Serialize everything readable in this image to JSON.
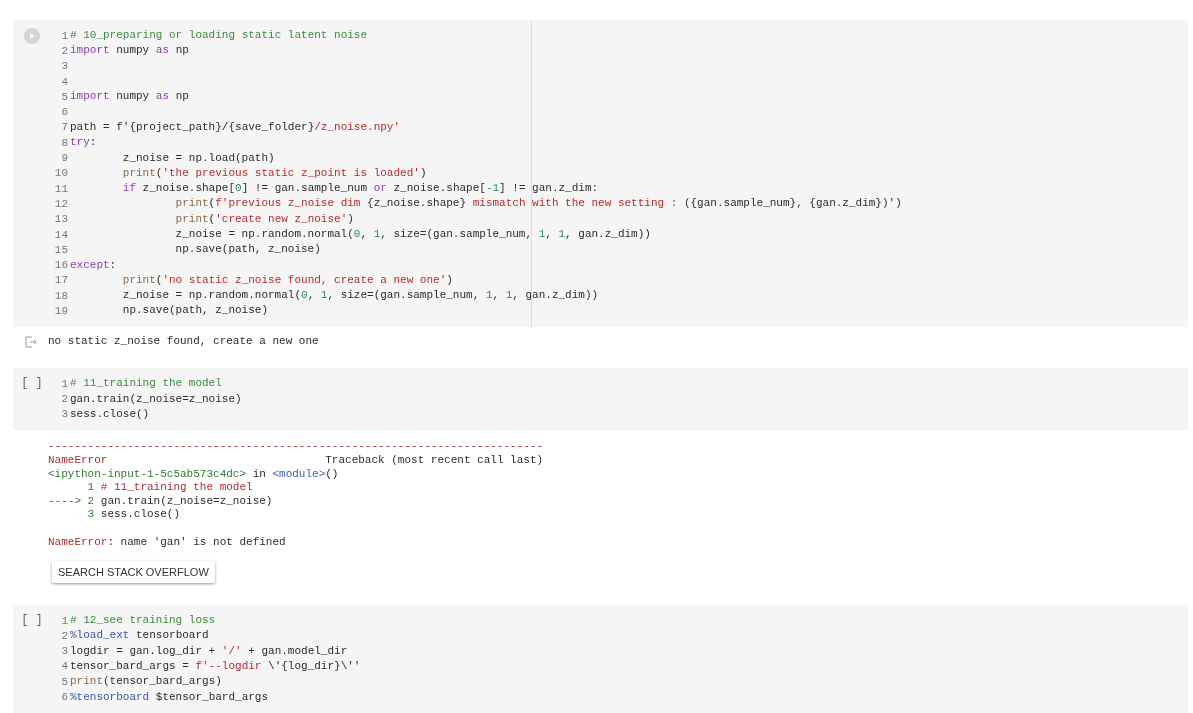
{
  "cells": [
    {
      "gutter": {
        "kind": "run"
      },
      "focused": true,
      "lines": [
        {
          "n": "1",
          "tokens": [
            {
              "kind": "comment",
              "text": "# 10_preparing or loading static latent noise"
            }
          ]
        },
        {
          "n": "2",
          "tokens": [
            {
              "kind": "keyword",
              "text": "import"
            },
            {
              "kind": "plain",
              "text": " numpy "
            },
            {
              "kind": "keyword",
              "text": "as"
            },
            {
              "kind": "plain",
              "text": " np"
            }
          ]
        },
        {
          "n": "3"
        },
        {
          "n": "4"
        },
        {
          "n": "5",
          "tokens": [
            {
              "kind": "keyword",
              "text": "import"
            },
            {
              "kind": "plain",
              "text": " numpy "
            },
            {
              "kind": "keyword",
              "text": "as"
            },
            {
              "kind": "plain",
              "text": " np"
            }
          ]
        },
        {
          "n": "6"
        },
        {
          "n": "7",
          "tokens": [
            {
              "kind": "plain",
              "text": "path = f'{project_path}/{save_folder}"
            },
            {
              "kind": "string",
              "text": "/z_noise.npy'"
            }
          ]
        },
        {
          "n": "8",
          "tokens": [
            {
              "kind": "keyword",
              "text": "try"
            },
            {
              "kind": "plain",
              "text": ":"
            }
          ],
          "children": [
            {
              "n": "9",
              "tokens": [
                {
                  "kind": "plain",
                  "text": "z_noise = np.load(path)"
                }
              ]
            },
            {
              "n": "10",
              "tokens": [
                {
                  "kind": "builtin",
                  "text": "print"
                },
                {
                  "kind": "plain",
                  "text": "("
                },
                {
                  "kind": "string",
                  "text": "'the previous static z_point is loaded'"
                },
                {
                  "kind": "plain",
                  "text": ")"
                }
              ]
            },
            {
              "n": "11",
              "tokens": [
                {
                  "kind": "keyword",
                  "text": "if"
                },
                {
                  "kind": "plain",
                  "text": " z_noise.shape["
                },
                {
                  "kind": "number",
                  "text": "0"
                },
                {
                  "kind": "plain",
                  "text": "] != gan.sample_num "
                },
                {
                  "kind": "keyword",
                  "text": "or"
                },
                {
                  "kind": "plain",
                  "text": " z_noise.shape["
                },
                {
                  "kind": "number",
                  "text": "-1"
                },
                {
                  "kind": "plain",
                  "text": "] != gan.z_dim:"
                }
              ],
              "children": [
                {
                  "n": "12",
                  "tokens": [
                    {
                      "kind": "builtin",
                      "text": "print"
                    },
                    {
                      "kind": "plain",
                      "text": "("
                    },
                    {
                      "kind": "string",
                      "text": "f'previous z_noise dim "
                    },
                    {
                      "kind": "plain",
                      "text": "{z_noise.shape}"
                    },
                    {
                      "kind": "string",
                      "text": " mismatch with the new setting : "
                    },
                    {
                      "kind": "plain",
                      "text": "({gan.sample_num}, {gan.z_dim})')"
                    }
                  ]
                },
                {
                  "n": "13",
                  "tokens": [
                    {
                      "kind": "builtin",
                      "text": "print"
                    },
                    {
                      "kind": "plain",
                      "text": "("
                    },
                    {
                      "kind": "string",
                      "text": "'create new z_noise'"
                    },
                    {
                      "kind": "plain",
                      "text": ")"
                    }
                  ]
                },
                {
                  "n": "14",
                  "tokens": [
                    {
                      "kind": "plain",
                      "text": "z_noise = np.random.normal("
                    },
                    {
                      "kind": "number",
                      "text": "0"
                    },
                    {
                      "kind": "plain",
                      "text": ", "
                    },
                    {
                      "kind": "number",
                      "text": "1"
                    },
                    {
                      "kind": "plain",
                      "text": ", size=(gan.sample_num, "
                    },
                    {
                      "kind": "number",
                      "text": "1"
                    },
                    {
                      "kind": "plain",
                      "text": ", "
                    },
                    {
                      "kind": "number",
                      "text": "1"
                    },
                    {
                      "kind": "plain",
                      "text": ", gan.z_dim))"
                    }
                  ]
                },
                {
                  "n": "15",
                  "tokens": [
                    {
                      "kind": "plain",
                      "text": "np.save(path, z_noise)"
                    }
                  ]
                }
              ]
            }
          ]
        },
        {
          "n": "16",
          "tokens": [
            {
              "kind": "keyword",
              "text": "except"
            },
            {
              "kind": "plain",
              "text": ":"
            }
          ],
          "children": [
            {
              "n": "17",
              "tokens": [
                {
                  "kind": "builtin",
                  "text": "print"
                },
                {
                  "kind": "plain",
                  "text": "("
                },
                {
                  "kind": "string",
                  "text": "'no static z_noise found, create a new one'"
                },
                {
                  "kind": "plain",
                  "text": ")"
                }
              ]
            },
            {
              "n": "18",
              "tokens": [
                {
                  "kind": "plain",
                  "text": "z_noise = np.random.normal("
                },
                {
                  "kind": "number",
                  "text": "0"
                },
                {
                  "kind": "plain",
                  "text": ", "
                },
                {
                  "kind": "number",
                  "text": "1"
                },
                {
                  "kind": "plain",
                  "text": ", size=(gan.sample_num, "
                },
                {
                  "kind": "number",
                  "text": "1"
                },
                {
                  "kind": "plain",
                  "text": ", "
                },
                {
                  "kind": "number",
                  "text": "1"
                },
                {
                  "kind": "plain",
                  "text": ", gan.z_dim))"
                }
              ]
            },
            {
              "n": "19",
              "tokens": [
                {
                  "kind": "plain",
                  "text": "np.save(path, z_noise)"
                }
              ]
            }
          ]
        }
      ],
      "output": {
        "kind": "stream",
        "lines": [
          [
            {
              "kind": "plain",
              "text": "no static z_noise found, create a new one"
            }
          ]
        ]
      }
    },
    {
      "gutter": {
        "kind": "count",
        "text": "[ ]"
      },
      "focused": false,
      "lines": [
        {
          "n": "1",
          "tokens": [
            {
              "kind": "comment",
              "text": "# 11_training the model"
            }
          ]
        },
        {
          "n": "2",
          "tokens": [
            {
              "kind": "plain",
              "text": "gan.train(z_noise=z_noise)"
            }
          ]
        },
        {
          "n": "3",
          "tokens": [
            {
              "kind": "plain",
              "text": "sess.close()"
            }
          ]
        }
      ],
      "output": {
        "kind": "error",
        "lines": [
          [
            {
              "kind": "error",
              "text": "---------------------------------------------------------------------------"
            }
          ],
          [
            {
              "kind": "error",
              "text": "NameError"
            },
            {
              "kind": "plain",
              "text": "                                 Traceback (most recent call last)"
            }
          ],
          [
            {
              "kind": "path",
              "text": "<ipython-input-1-5c5ab573c4dc>"
            },
            {
              "kind": "plain",
              "text": " in "
            },
            {
              "kind": "module",
              "text": "<module>"
            },
            {
              "kind": "plain",
              "text": "()"
            }
          ],
          [
            {
              "kind": "path",
              "text": "      1 "
            },
            {
              "kind": "error",
              "text": "# 11_training the model"
            }
          ],
          [
            {
              "kind": "path",
              "text": "----> 2 "
            },
            {
              "kind": "plain",
              "text": "gan.train(z_noise=z_noise)"
            }
          ],
          [
            {
              "kind": "path",
              "text": "      3 "
            },
            {
              "kind": "plain",
              "text": "sess.close()"
            }
          ]
        ],
        "message": [
          {
            "kind": "error",
            "text": "NameError"
          },
          {
            "kind": "plain",
            "text": ": name 'gan' is not defined"
          }
        ],
        "button": "SEARCH STACK OVERFLOW"
      }
    },
    {
      "gutter": {
        "kind": "count",
        "text": "[ ]"
      },
      "focused": false,
      "lines": [
        {
          "n": "1",
          "tokens": [
            {
              "kind": "comment",
              "text": "# 12_see training loss"
            }
          ]
        },
        {
          "n": "2",
          "tokens": [
            {
              "kind": "magic",
              "text": "%load_ext"
            },
            {
              "kind": "plain",
              "text": " tensorboard"
            }
          ]
        },
        {
          "n": "3",
          "tokens": [
            {
              "kind": "plain",
              "text": "logdir = gan.log_dir + "
            },
            {
              "kind": "string",
              "text": "'/'"
            },
            {
              "kind": "plain",
              "text": " + gan.model_dir"
            }
          ]
        },
        {
          "n": "4",
          "tokens": [
            {
              "kind": "plain",
              "text": "tensor_bard_args = "
            },
            {
              "kind": "string",
              "text": "f'--logdir"
            },
            {
              "kind": "plain",
              "text": " \\'{log_dir}\\''"
            }
          ]
        },
        {
          "n": "5",
          "tokens": [
            {
              "kind": "builtin",
              "text": "print"
            },
            {
              "kind": "plain",
              "text": "(tensor_bard_args)"
            }
          ]
        },
        {
          "n": "6",
          "tokens": [
            {
              "kind": "magic",
              "text": "%tensorboard"
            },
            {
              "kind": "plain",
              "text": " $tensor_bard_args"
            }
          ]
        }
      ]
    }
  ]
}
